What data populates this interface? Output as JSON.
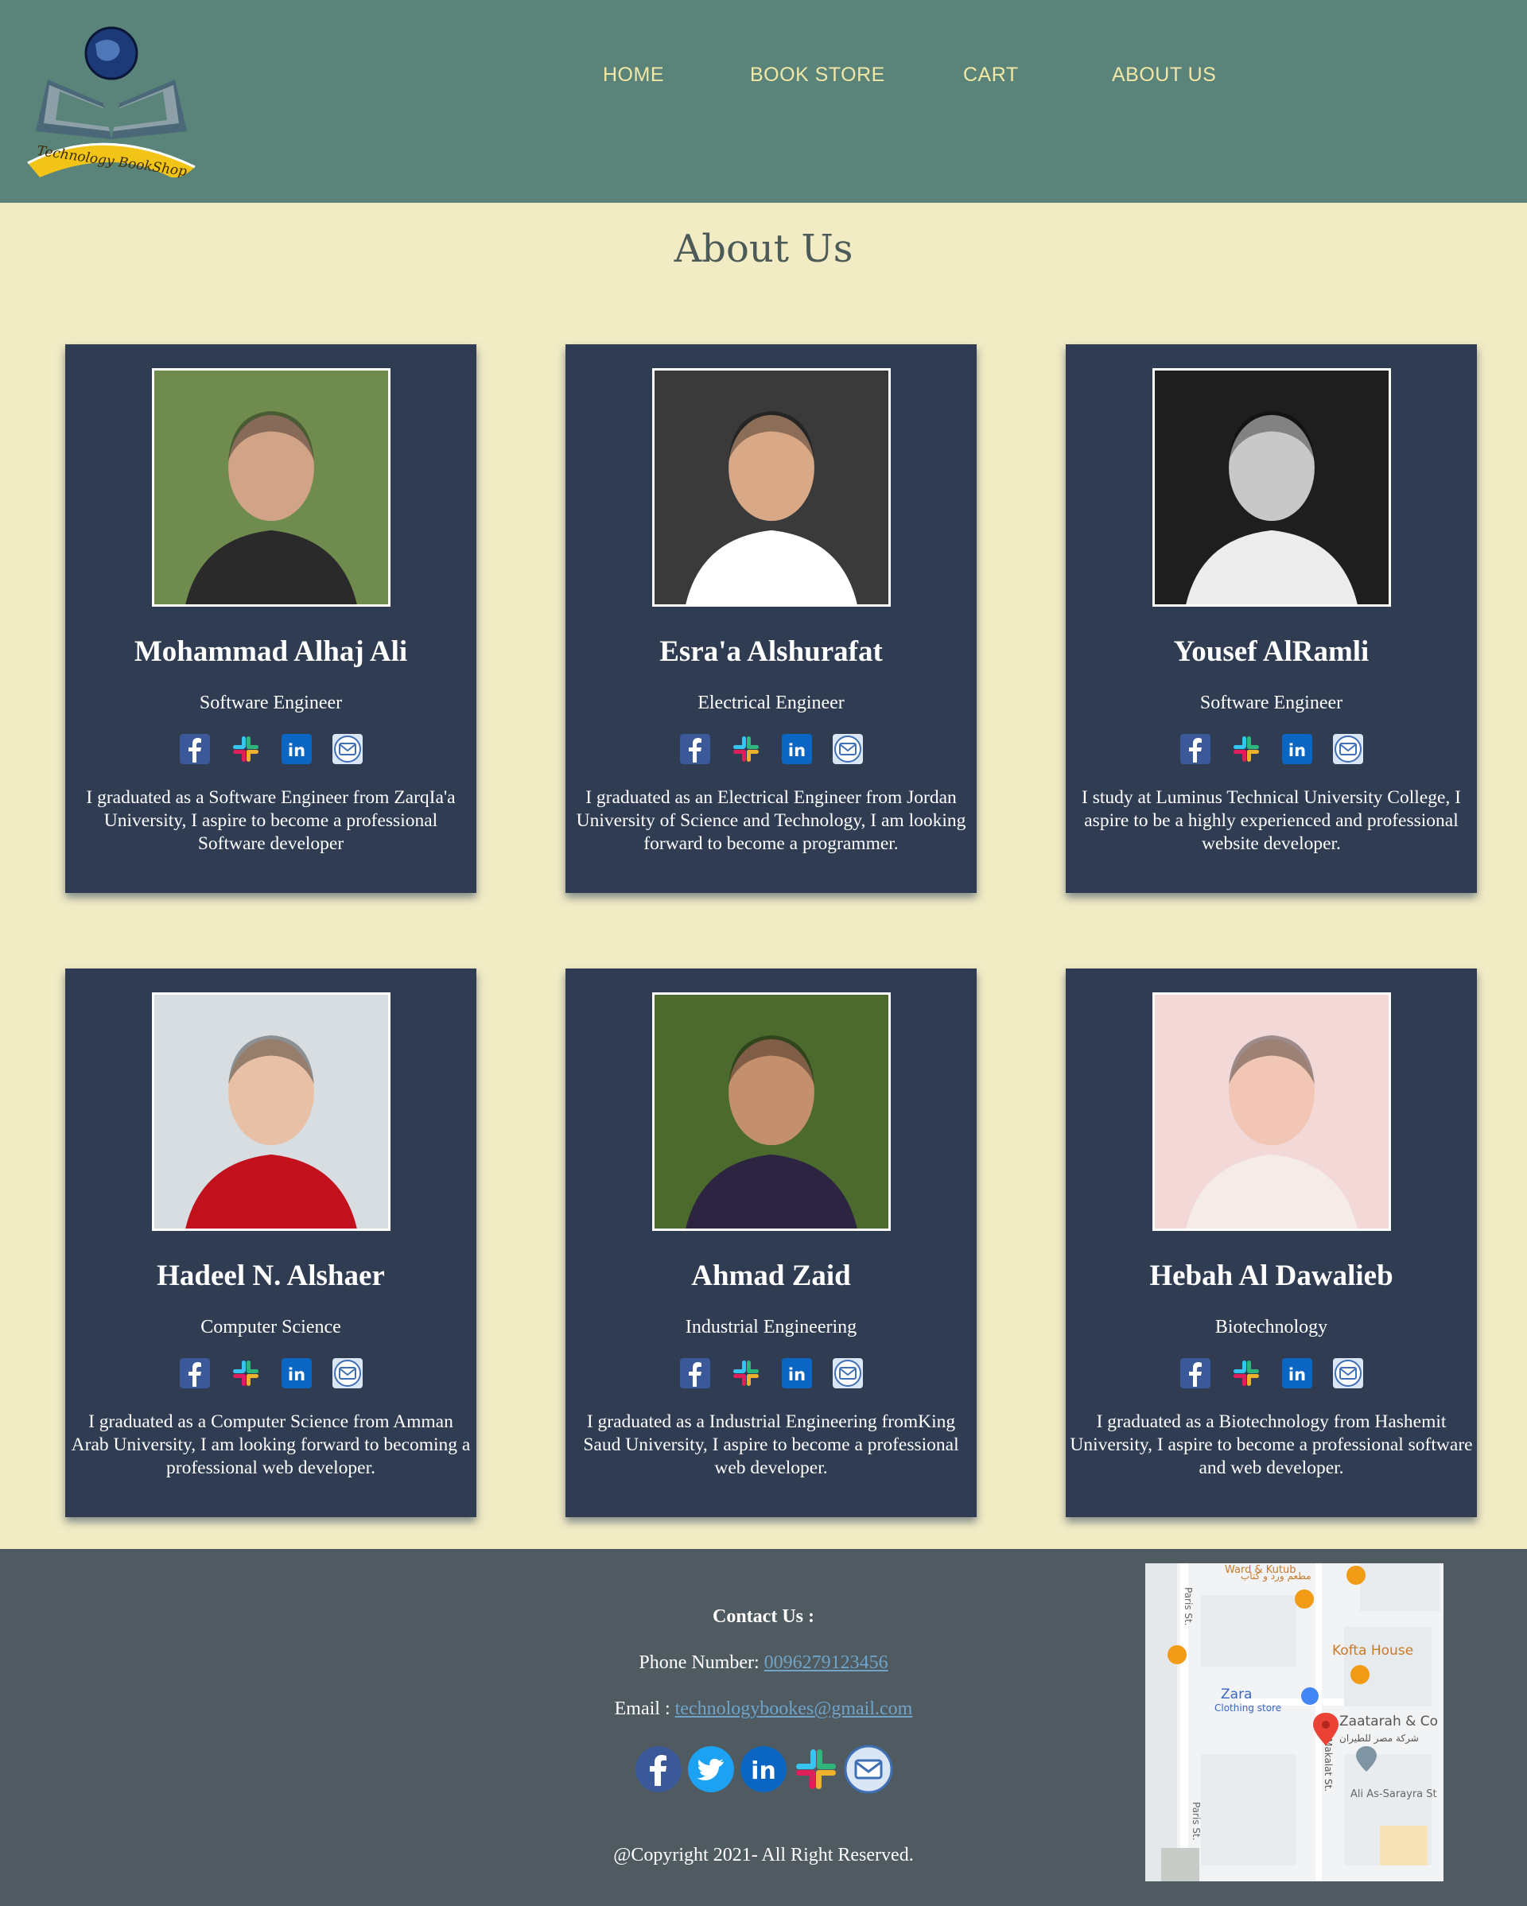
{
  "logo": {
    "text": "Technology BookShop",
    "icon": "book-globe-logo"
  },
  "nav": {
    "items": [
      {
        "label": "HOME"
      },
      {
        "label": "BOOK STORE"
      },
      {
        "label": "CART"
      },
      {
        "label": "ABOUT US"
      }
    ]
  },
  "page": {
    "title": "About Us"
  },
  "team": [
    {
      "name": "Mohammad Alhaj Ali",
      "role": "Software Engineer",
      "desc": "I graduated as a Software Engineer from ZarqIa'a University, I aspire to become a professional Software developer"
    },
    {
      "name": "Esra'a Alshurafat",
      "role": "Electrical Engineer",
      "desc": "I graduated as an Electrical Engineer from Jordan University of Science and Technology, I am looking forward to become a programmer."
    },
    {
      "name": "Yousef AlRamli",
      "role": "Software Engineer",
      "desc": "I study at Luminus Technical University College, I aspire to be a highly experienced and professional website developer."
    },
    {
      "name": "Hadeel N. Alshaer",
      "role": "Computer Science",
      "desc": "I graduated as a Computer Science from Amman Arab University, I am looking forward to becoming a professional web developer."
    },
    {
      "name": "Ahmad Zaid",
      "role": "Industrial Engineering",
      "desc": "I graduated as a Industrial Engineering fromKing Saud University, I aspire to become a professional web developer."
    },
    {
      "name": "Hebah Al Dawalieb",
      "role": "Biotechnology",
      "desc": "I graduated as a Biotechnology from Hashemit University, I aspire to become a professional software and web developer."
    }
  ],
  "card_icons": [
    "facebook-icon",
    "slack-icon",
    "linkedin-icon",
    "email-icon"
  ],
  "footer": {
    "contact_heading": "Contact Us :",
    "phone_label": "Phone Number:",
    "phone": "0096279123456",
    "email_label": "Email :",
    "email": "technologybookes@gmail.com",
    "social_icons": [
      "facebook-icon",
      "twitter-icon",
      "linkedin-icon",
      "slack-icon",
      "email-icon"
    ],
    "copyright": "@Copyright 2021- All Right Reserved."
  },
  "map": {
    "labels": [
      "Ward & Kutub",
      "مطعم ورد و كتاب",
      "Paris St.",
      "Kofta House",
      "Zara",
      "Clothing store",
      "Zaatarah & Co",
      "شركة مصر للطيران",
      "Makalat St.",
      "Ali As-Sarayra St",
      "Paris St."
    ]
  },
  "colors": {
    "header": "#5a8479",
    "nav_text": "#f2e7a6",
    "background": "#f2ecc5",
    "card": "#2f3c52",
    "footer": "#4f5b60",
    "link": "#6fa3c8"
  }
}
